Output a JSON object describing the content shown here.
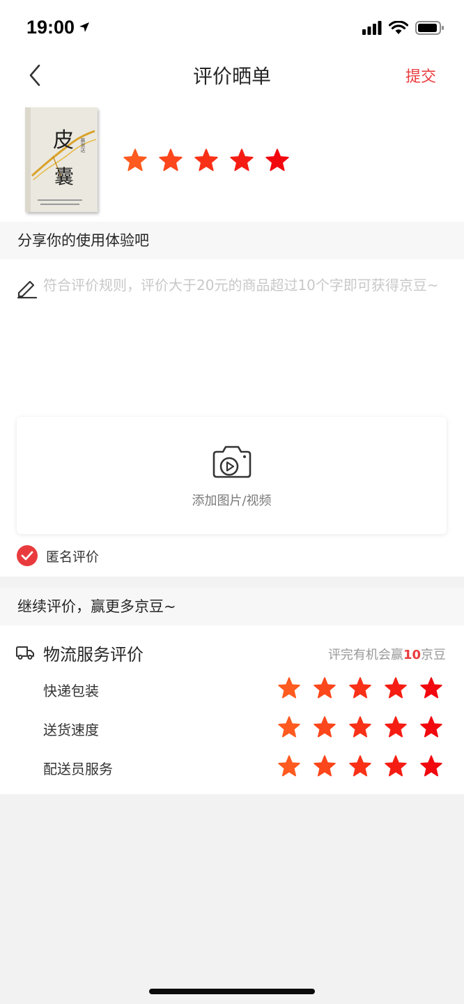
{
  "status_bar": {
    "time": "19:00"
  },
  "nav": {
    "title": "评价晒单",
    "submit": "提交"
  },
  "product": {
    "cover_title_1": "皮",
    "cover_title_2": "囊",
    "cover_author": "蔡崇达",
    "rating": 5
  },
  "share_section": {
    "title": "分享你的使用体验吧"
  },
  "review": {
    "placeholder": "符合评价规则，评价大于20元的商品超过10个字即可获得京豆~",
    "value": ""
  },
  "upload": {
    "label": "添加图片/视频"
  },
  "anonymous": {
    "label": "匿名评价",
    "checked": true
  },
  "continue_section": {
    "title": "继续评价，赢更多京豆~"
  },
  "logistics": {
    "title": "物流服务评价",
    "hint_prefix": "评完有机会赢",
    "hint_count": "10",
    "hint_suffix": "京豆",
    "items": [
      {
        "label": "快递包装",
        "rating": 5
      },
      {
        "label": "送货速度",
        "rating": 5
      },
      {
        "label": "配送员服务",
        "rating": 5
      }
    ]
  },
  "colors": {
    "accent": "#e93b3d",
    "star_light": "#ff5a1f",
    "star_dark": "#f1080f"
  }
}
